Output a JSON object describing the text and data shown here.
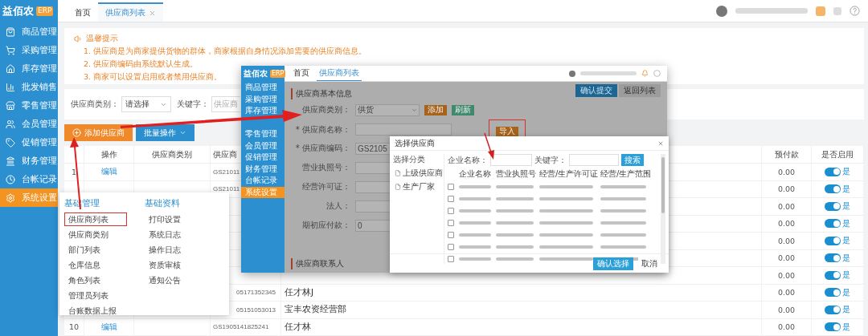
{
  "sidebar": {
    "logo": "益佰农",
    "badge": "ERP",
    "items": [
      {
        "label": "商品管理",
        "selected": false
      },
      {
        "label": "采购管理",
        "selected": false
      },
      {
        "label": "库存管理",
        "selected": false
      },
      {
        "label": "批发销售",
        "selected": false
      },
      {
        "label": "零售管理",
        "selected": false
      },
      {
        "label": "会员管理",
        "selected": false
      },
      {
        "label": "促销管理",
        "selected": false
      },
      {
        "label": "财务管理",
        "selected": false
      },
      {
        "label": "台帐记录",
        "selected": false
      },
      {
        "label": "系统设置",
        "selected": true
      }
    ]
  },
  "tabs": [
    {
      "label": "首页",
      "selected": false
    },
    {
      "label": "供应商列表",
      "selected": true
    }
  ],
  "tip": {
    "title": "温馨提示",
    "lines": [
      "1. 供应商是为商家提供货物的群体，商家根据自身情况添加需要的供应商信息。",
      "2. 供应商编码由系统默认生成。",
      "3. 商家可以设置启用或者禁用供应商。"
    ]
  },
  "filters": {
    "category_label": "供应商类别：",
    "category_value": "请选择",
    "keyword_label": "关键字：",
    "keyword_placeholder": "供应商"
  },
  "buttons": [
    {
      "label": "添加供应商",
      "kind": "add"
    },
    {
      "label": "批量操作",
      "kind": "dropdown"
    }
  ],
  "table": {
    "columns": [
      "操作",
      "供应商类别",
      "供应商",
      "预付款",
      "是否启用"
    ],
    "rows": [
      {
        "number": "1",
        "action": "编辑",
        "code": "GS21011",
        "code_cut": false,
        "prepaid": "0.00",
        "enabled": true,
        "enabled_label": "是"
      },
      {
        "code": "GS21011",
        "code_cut": false,
        "prepaid": "0.00",
        "enabled": true,
        "enabled_label": "是"
      },
      {
        "prepaid": "0.00",
        "enabled": true,
        "enabled_label": "是"
      },
      {
        "prepaid": "0.00",
        "enabled": true,
        "enabled_label": "是"
      },
      {
        "prepaid": "0.00",
        "enabled": true,
        "enabled_label": "是"
      },
      {
        "prepaid": "0.00",
        "enabled": true,
        "enabled_label": "是"
      },
      {
        "prepaid": "0.00",
        "enabled": true,
        "enabled_label": "是"
      },
      {
        "code": "05171352345",
        "code_cut": true,
        "name": "任才林J",
        "prepaid": "0.00",
        "enabled": true,
        "enabled_label": "是"
      },
      {
        "code": "05151053013",
        "code_cut": true,
        "name": "宝丰农资经营部",
        "prepaid": "0.00",
        "enabled": true,
        "enabled_label": "是"
      },
      {
        "number": "10",
        "action": "编辑",
        "code": "GS1905141825241",
        "code_cut": false,
        "name": "任才林",
        "prepaid": "0.00",
        "enabled": true,
        "enabled_label": "是"
      }
    ]
  },
  "menu": {
    "columns": [
      {
        "title": "基础管理",
        "items": [
          {
            "label": "供应商列表",
            "highlighted": true
          },
          {
            "label": "供应商类别",
            "highlighted": false
          },
          {
            "label": "部门列表",
            "highlighted": false
          },
          {
            "label": "仓库信息",
            "highlighted": false
          },
          {
            "label": "角色列表",
            "highlighted": false
          },
          {
            "label": "管理员列表",
            "highlighted": false
          },
          {
            "label": "台账数据上报",
            "highlighted": false
          }
        ]
      },
      {
        "title": "基础资料",
        "items": [
          {
            "label": "打印设置",
            "highlighted": false
          },
          {
            "label": "系统日志",
            "highlighted": false
          },
          {
            "label": "操作日志",
            "highlighted": false
          },
          {
            "label": "资质审核",
            "highlighted": false
          },
          {
            "label": "通知公告",
            "highlighted": false
          }
        ]
      }
    ]
  },
  "inset": {
    "logo": "益佰农",
    "badge": "ERP",
    "menu": [
      {
        "label": "商品管理",
        "selected": false
      },
      {
        "label": "采购管理",
        "selected": false
      },
      {
        "label": "库存管理",
        "selected": false
      },
      {
        "selected": false
      },
      {
        "label": "零售管理",
        "selected": false
      },
      {
        "label": "会员管理",
        "selected": false
      },
      {
        "label": "促销管理",
        "selected": false
      },
      {
        "label": "财务管理",
        "selected": false
      },
      {
        "label": "台帐记录",
        "selected": false
      },
      {
        "label": "系统设置",
        "selected": true
      }
    ],
    "tabs": [
      {
        "label": "首页",
        "selected": false
      },
      {
        "label": "供应商列表",
        "selected": true
      }
    ],
    "actions": [
      {
        "label": "确认提交",
        "kind": "primary"
      },
      {
        "label": "返回列表",
        "kind": "plain"
      }
    ],
    "section": "供应商基本信息",
    "form": [
      {
        "label": "供应商类别：",
        "kind": "select",
        "value": "供货",
        "buttons": [
          {
            "label": "添加",
            "kind": "orange",
            "highlighted": false
          },
          {
            "label": "刷新",
            "kind": "green",
            "highlighted": false
          }
        ]
      },
      {
        "label": "* 供应商名称：",
        "kind": "input",
        "buttons": [
          {
            "label": "导入",
            "kind": "orange",
            "highlighted": true
          }
        ]
      },
      {
        "label": "* 供应商编码：",
        "kind": "input",
        "value": "GS2105"
      },
      {
        "label": "营业执照号：",
        "kind": "input"
      },
      {
        "label": "经营许可证：",
        "kind": "input"
      },
      {
        "label": "法人：",
        "kind": "input"
      },
      {
        "label": "期初应付款：",
        "kind": "input",
        "value": "0"
      }
    ],
    "footer_section": "供应商联系人",
    "dialog": {
      "title": "选择供应商",
      "tree_title": "选择分类",
      "tree_items": [
        "上级供应商",
        "生产厂家"
      ],
      "name_label": "企业名称：",
      "keyword_label": "关键字：",
      "search": "搜索",
      "columns": [
        "企业名称",
        "营业执照号",
        "经营/生产许可证",
        "经营/生产范围"
      ],
      "rows": [
        {
          "checked": false
        },
        {
          "checked": false
        },
        {
          "checked": false
        },
        {
          "checked": false
        },
        {
          "checked": false
        },
        {
          "checked": false
        },
        {
          "checked": false
        }
      ],
      "confirm": "确认选择",
      "cancel": "取消"
    }
  }
}
